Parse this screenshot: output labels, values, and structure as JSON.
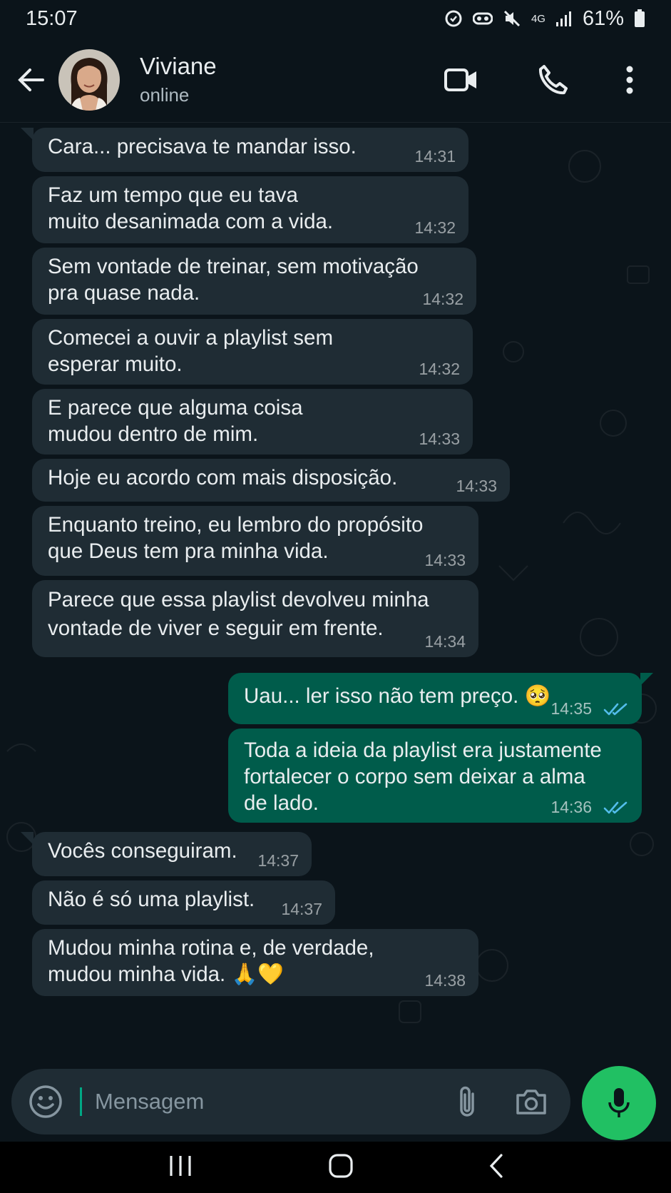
{
  "status_bar": {
    "time": "15:07",
    "network": "4G",
    "battery": "61%"
  },
  "header": {
    "contact_name": "Viviane",
    "contact_status": "online"
  },
  "messages": [
    {
      "dir": "in",
      "text": "Cara... precisava te mandar isso.",
      "time": "14:31"
    },
    {
      "dir": "in",
      "text": "Faz um tempo que eu tava\nmuito desanimada com a vida.",
      "time": "14:32"
    },
    {
      "dir": "in",
      "text": "Sem vontade de treinar, sem motivação\npra quase nada.",
      "time": "14:32"
    },
    {
      "dir": "in",
      "text": "Comecei a ouvir a playlist sem\nesperar muito.",
      "time": "14:32"
    },
    {
      "dir": "in",
      "text": "E parece que alguma coisa\nmudou dentro de mim.",
      "time": "14:33"
    },
    {
      "dir": "in",
      "text": "Hoje eu acordo com mais disposição.",
      "time": "14:33"
    },
    {
      "dir": "in",
      "text": "Enquanto treino, eu lembro do propósito\nque Deus tem pra minha vida.",
      "time": "14:33"
    },
    {
      "dir": "in",
      "text": "Parece que essa playlist devolveu minha\nvontade de viver e seguir em frente.",
      "time": "14:34"
    },
    {
      "dir": "out",
      "text": "Uau... ler isso não tem preço. 🥺",
      "time": "14:35"
    },
    {
      "dir": "out",
      "text": "Toda a ideia da playlist era justamente\nfortalecer o corpo sem deixar a alma\nde lado.",
      "time": "14:36"
    },
    {
      "dir": "in",
      "text": "Vocês conseguiram.",
      "time": "14:37"
    },
    {
      "dir": "in",
      "text": "Não é só uma playlist.",
      "time": "14:37"
    },
    {
      "dir": "in",
      "text": "Mudou minha rotina e, de verdade,\nmudou minha vida. 🙏💛",
      "time": "14:38"
    }
  ],
  "composer": {
    "placeholder": "Mensagem"
  },
  "colors": {
    "incoming": "#1f2c34",
    "outgoing": "#005c4b",
    "accent": "#21c063",
    "read_ticks": "#53bdeb"
  }
}
